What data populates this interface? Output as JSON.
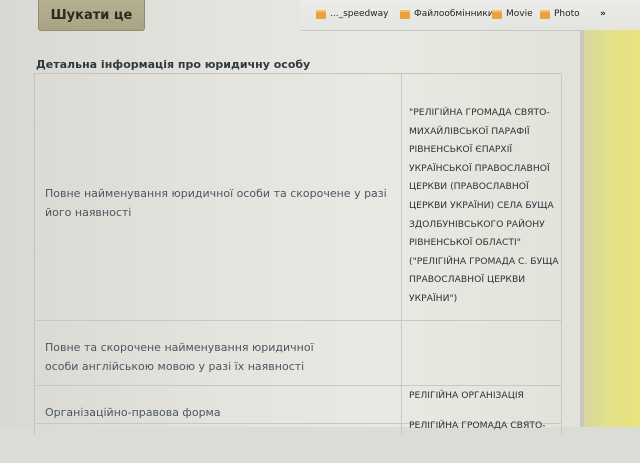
{
  "toolbar": {
    "search_label": "Шукати це"
  },
  "bookmarks_bar": {
    "items": [
      {
        "label": "..._speedway",
        "icon": "folder-icon"
      },
      {
        "label": "Файлообмінники",
        "icon": "folder-icon"
      },
      {
        "label": "Movie",
        "icon": "folder-icon"
      },
      {
        "label": "Photo",
        "icon": "folder-icon"
      },
      {
        "label": "»",
        "icon": ""
      }
    ]
  },
  "section": {
    "title": "Детальна інформація про юридичну особу"
  },
  "table": {
    "rows": [
      {
        "label": "Повне найменування юридичної особи та скорочене у разі його наявності",
        "value_lines": [
          "\"РЕЛІГІЙНА ГРОМАДА СВЯТО-",
          "МИХАЙЛІВСЬКОЇ ПАРАФІЇ",
          "РІВНЕНСЬКОЇ ЄПАРХІЇ",
          "УКРАЇНСЬКОЇ ПРАВОСЛАВНОЇ",
          "ЦЕРКВИ (ПРАВОСЛАВНОЇ",
          "ЦЕРКВИ УКРАЇНИ) СЕЛА БУЩА",
          "ЗДОЛБУНІВСЬКОГО РАЙОНУ",
          "РІВНЕНСЬКОЇ ОБЛАСТІ\"",
          "(\"РЕЛІГІЙНА ГРОМАДА С. БУЩА",
          "ПРАВОСЛАВНОЇ ЦЕРКВИ",
          "УКРАЇНИ\")"
        ]
      },
      {
        "label": "Повне та скорочене найменування юридичної особи англійською мовою у разі їх наявності",
        "value_lines": []
      },
      {
        "label": "Організаційно-правова форма",
        "value_lines": [
          "РЕЛІГІЙНА ОРГАНІЗАЦІЯ"
        ]
      },
      {
        "label": "",
        "value_lines": [
          "РЕЛІГІЙНА ГРОМАДА СВЯТО-"
        ]
      }
    ]
  }
}
